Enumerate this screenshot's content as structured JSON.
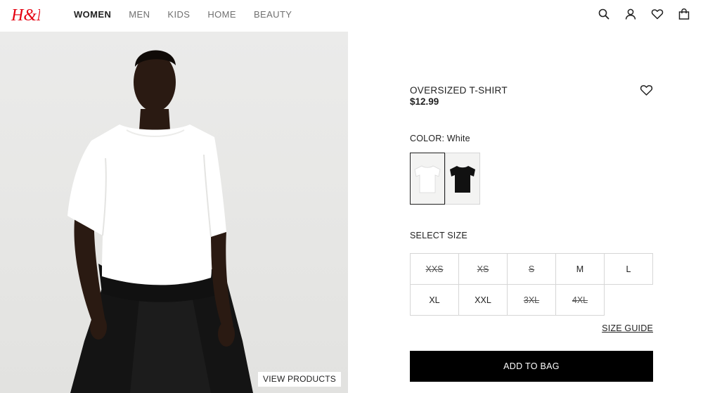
{
  "header": {
    "logo_text": "H&M",
    "nav": [
      {
        "label": "WOMEN",
        "active": true
      },
      {
        "label": "MEN",
        "active": false
      },
      {
        "label": "KIDS",
        "active": false
      },
      {
        "label": "HOME",
        "active": false
      },
      {
        "label": "BEAUTY",
        "active": false
      }
    ],
    "icons": [
      "search-icon",
      "account-icon",
      "favorites-icon",
      "bag-icon"
    ]
  },
  "hero": {
    "view_products_label": "VIEW PRODUCTS"
  },
  "product": {
    "title": "OVERSIZED T-SHIRT",
    "price": "$12.99",
    "color_label": "COLOR: White",
    "swatches": [
      {
        "name": "White",
        "selected": true,
        "shirt_color": "#ffffff"
      },
      {
        "name": "Black",
        "selected": false,
        "shirt_color": "#111111"
      }
    ],
    "size_label": "SELECT SIZE",
    "sizes": [
      {
        "label": "XXS",
        "available": false
      },
      {
        "label": "XS",
        "available": false
      },
      {
        "label": "S",
        "available": false
      },
      {
        "label": "M",
        "available": true
      },
      {
        "label": "L",
        "available": true
      },
      {
        "label": "XL",
        "available": true
      },
      {
        "label": "XXL",
        "available": true
      },
      {
        "label": "3XL",
        "available": false
      },
      {
        "label": "4XL",
        "available": false
      }
    ],
    "size_guide_label": "SIZE GUIDE",
    "add_to_bag_label": "ADD TO BAG"
  },
  "colors": {
    "accent": "#e50010",
    "text": "#222222",
    "muted": "#707070",
    "border": "#d6d6d6",
    "button_bg": "#000000"
  }
}
